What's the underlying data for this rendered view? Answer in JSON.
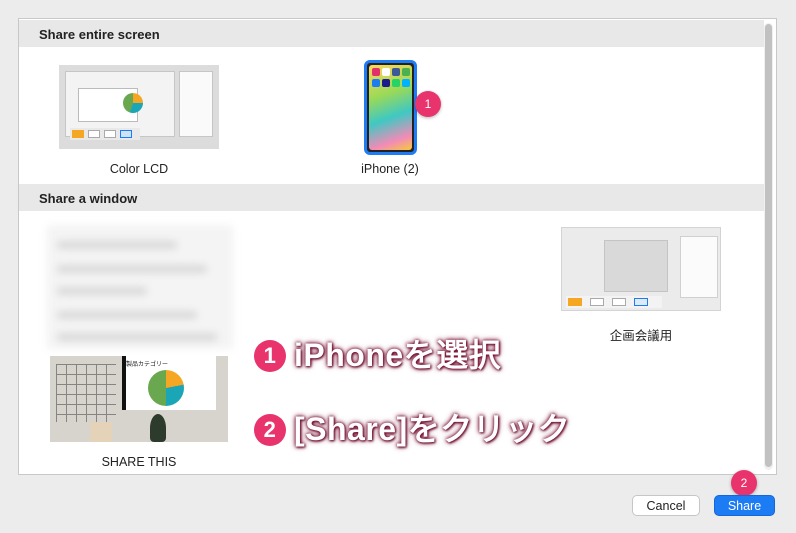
{
  "sections": {
    "screen_header": "Share entire screen",
    "window_header": "Share a window"
  },
  "screens": [
    {
      "label": "Color LCD"
    },
    {
      "label": "iPhone (2)",
      "selected": true
    }
  ],
  "windows": [
    {
      "label": ""
    },
    {
      "label": "企画会議用"
    },
    {
      "label": "SHARE THIS",
      "slide_title": "製品カテゴリー"
    }
  ],
  "badges": {
    "one": "1",
    "two": "2"
  },
  "annotations": {
    "step1_num": "1",
    "step1_text": "iPhoneを選択",
    "step2_num": "2",
    "step2_text": "[Share]をクリック"
  },
  "buttons": {
    "cancel": "Cancel",
    "share": "Share"
  },
  "colors": {
    "accent": "#1c7cf4",
    "badge": "#e8336d"
  }
}
